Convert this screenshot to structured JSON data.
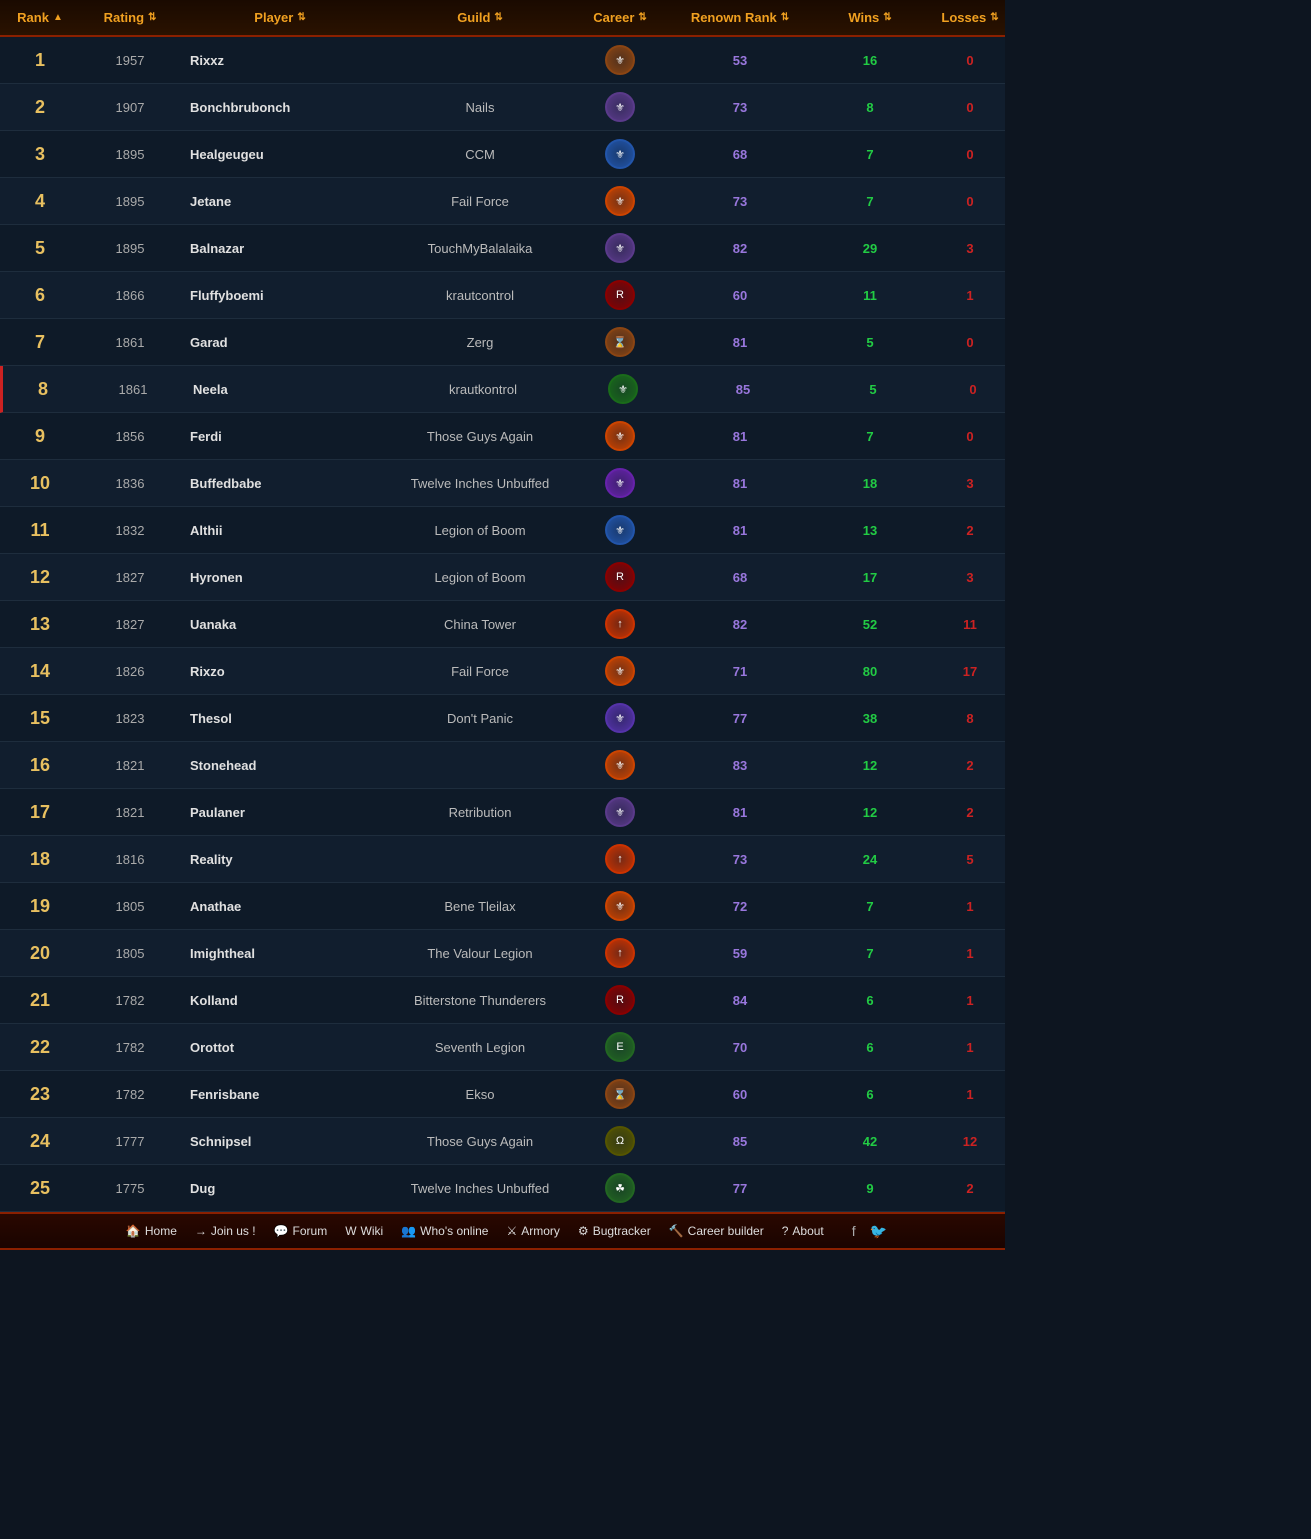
{
  "header": {
    "columns": [
      {
        "key": "rank",
        "label": "Rank",
        "sortable": true,
        "class": "gold"
      },
      {
        "key": "rating",
        "label": "Rating",
        "sortable": true,
        "class": "gold"
      },
      {
        "key": "player",
        "label": "Player",
        "sortable": true,
        "class": "gold"
      },
      {
        "key": "guild",
        "label": "Guild",
        "sortable": true,
        "class": "gold"
      },
      {
        "key": "career",
        "label": "Career",
        "sortable": true,
        "class": "gold"
      },
      {
        "key": "renown",
        "label": "Renown Rank",
        "sortable": true,
        "class": "gold"
      },
      {
        "key": "wins",
        "label": "Wins",
        "sortable": true,
        "class": "gold"
      },
      {
        "key": "losses",
        "label": "Losses",
        "sortable": true,
        "class": "gold"
      }
    ]
  },
  "rows": [
    {
      "rank": 1,
      "rating": 1957,
      "player": "Rixxz",
      "guild": "",
      "career_color": "#8b4513",
      "career_symbol": "⚜",
      "renown": 53,
      "wins": 16,
      "losses": 0
    },
    {
      "rank": 2,
      "rating": 1907,
      "player": "Bonchbrubonch",
      "guild": "Nails",
      "career_color": "#5a3a8a",
      "career_symbol": "⚜",
      "renown": 73,
      "wins": 8,
      "losses": 0
    },
    {
      "rank": 3,
      "rating": 1895,
      "player": "Healgeugeu",
      "guild": "CCM",
      "career_color": "#2255aa",
      "career_symbol": "⚜",
      "renown": 68,
      "wins": 7,
      "losses": 0
    },
    {
      "rank": 4,
      "rating": 1895,
      "player": "Jetane",
      "guild": "Fail Force",
      "career_color": "#cc4400",
      "career_symbol": "⚜",
      "renown": 73,
      "wins": 7,
      "losses": 0
    },
    {
      "rank": 5,
      "rating": 1895,
      "player": "Balnazar",
      "guild": "TouchMyBalalaika",
      "career_color": "#5a3a8a",
      "career_symbol": "⚜",
      "renown": 82,
      "wins": 29,
      "losses": 3
    },
    {
      "rank": 6,
      "rating": 1866,
      "player": "Fluffyboemi",
      "guild": "krautcontrol",
      "career_color": "#8b0000",
      "career_symbol": "R",
      "renown": 60,
      "wins": 11,
      "losses": 1
    },
    {
      "rank": 7,
      "rating": 1861,
      "player": "Garad",
      "guild": "Zerg",
      "career_color": "#8b4513",
      "career_symbol": "⌛",
      "renown": 81,
      "wins": 5,
      "losses": 0
    },
    {
      "rank": 8,
      "rating": 1861,
      "player": "Neela",
      "guild": "krautkontrol",
      "career_color": "#1a6b1a",
      "career_symbol": "⚜",
      "renown": 85,
      "wins": 5,
      "losses": 0,
      "highlight": true
    },
    {
      "rank": 9,
      "rating": 1856,
      "player": "Ferdi",
      "guild": "Those Guys Again",
      "career_color": "#cc4400",
      "career_symbol": "⚜",
      "renown": 81,
      "wins": 7,
      "losses": 0
    },
    {
      "rank": 10,
      "rating": 1836,
      "player": "Buffedbabe",
      "guild": "Twelve Inches Unbuffed",
      "career_color": "#6622aa",
      "career_symbol": "⚜",
      "renown": 81,
      "wins": 18,
      "losses": 3
    },
    {
      "rank": 11,
      "rating": 1832,
      "player": "Althii",
      "guild": "Legion of Boom",
      "career_color": "#2255aa",
      "career_symbol": "⚜",
      "renown": 81,
      "wins": 13,
      "losses": 2
    },
    {
      "rank": 12,
      "rating": 1827,
      "player": "Hyronen",
      "guild": "Legion of Boom",
      "career_color": "#8b0000",
      "career_symbol": "R",
      "renown": 68,
      "wins": 17,
      "losses": 3
    },
    {
      "rank": 13,
      "rating": 1827,
      "player": "Uanaka",
      "guild": "China Tower",
      "career_color": "#cc3300",
      "career_symbol": "↑",
      "renown": 82,
      "wins": 52,
      "losses": 11
    },
    {
      "rank": 14,
      "rating": 1826,
      "player": "Rixzo",
      "guild": "Fail Force",
      "career_color": "#cc4400",
      "career_symbol": "⚜",
      "renown": 71,
      "wins": 80,
      "losses": 17
    },
    {
      "rank": 15,
      "rating": 1823,
      "player": "Thesol",
      "guild": "Don't Panic",
      "career_color": "#5533aa",
      "career_symbol": "⚜",
      "renown": 77,
      "wins": 38,
      "losses": 8
    },
    {
      "rank": 16,
      "rating": 1821,
      "player": "Stonehead",
      "guild": "",
      "career_color": "#cc4400",
      "career_symbol": "⚜",
      "renown": 83,
      "wins": 12,
      "losses": 2
    },
    {
      "rank": 17,
      "rating": 1821,
      "player": "Paulaner",
      "guild": "Retribution",
      "career_color": "#5a3a8a",
      "career_symbol": "⚜",
      "renown": 81,
      "wins": 12,
      "losses": 2
    },
    {
      "rank": 18,
      "rating": 1816,
      "player": "Reality",
      "guild": "",
      "career_color": "#cc3300",
      "career_symbol": "↑",
      "renown": 73,
      "wins": 24,
      "losses": 5
    },
    {
      "rank": 19,
      "rating": 1805,
      "player": "Anathae",
      "guild": "Bene Tleilax",
      "career_color": "#cc4400",
      "career_symbol": "⚜",
      "renown": 72,
      "wins": 7,
      "losses": 1
    },
    {
      "rank": 20,
      "rating": 1805,
      "player": "Imightheal",
      "guild": "The Valour Legion",
      "career_color": "#cc3300",
      "career_symbol": "↑",
      "renown": 59,
      "wins": 7,
      "losses": 1
    },
    {
      "rank": 21,
      "rating": 1782,
      "player": "Kolland",
      "guild": "Bitterstone Thunderers",
      "career_color": "#8b0000",
      "career_symbol": "R",
      "renown": 84,
      "wins": 6,
      "losses": 1
    },
    {
      "rank": 22,
      "rating": 1782,
      "player": "Orottot",
      "guild": "Seventh Legion",
      "career_color": "#226622",
      "career_symbol": "E",
      "renown": 70,
      "wins": 6,
      "losses": 1
    },
    {
      "rank": 23,
      "rating": 1782,
      "player": "Fenrisbane",
      "guild": "Ekso",
      "career_color": "#8b4513",
      "career_symbol": "⌛",
      "renown": 60,
      "wins": 6,
      "losses": 1
    },
    {
      "rank": 24,
      "rating": 1777,
      "player": "Schnipsel",
      "guild": "Those Guys Again",
      "career_color": "#555500",
      "career_symbol": "Ω",
      "renown": 85,
      "wins": 42,
      "losses": 12
    },
    {
      "rank": 25,
      "rating": 1775,
      "player": "Dug",
      "guild": "Twelve Inches Unbuffed",
      "career_color": "#226622",
      "career_symbol": "☘",
      "renown": 77,
      "wins": 9,
      "losses": 2
    }
  ],
  "nav": {
    "items": [
      {
        "icon": "🏠",
        "label": "Home",
        "name": "home"
      },
      {
        "icon": "→",
        "label": "Join us !",
        "name": "join"
      },
      {
        "icon": "💬",
        "label": "Forum",
        "name": "forum"
      },
      {
        "icon": "W",
        "label": "Wiki",
        "name": "wiki"
      },
      {
        "icon": "👥",
        "label": "Who's online",
        "name": "whois"
      },
      {
        "icon": "⚔",
        "label": "Armory",
        "name": "armory"
      },
      {
        "icon": "⚙",
        "label": "Bugtracker",
        "name": "bugtracker"
      },
      {
        "icon": "🔨",
        "label": "Career builder",
        "name": "careerbuilder"
      },
      {
        "icon": "?",
        "label": "About",
        "name": "about"
      }
    ],
    "social": [
      {
        "icon": "f",
        "name": "facebook"
      },
      {
        "icon": "🐦",
        "name": "twitter"
      }
    ]
  }
}
